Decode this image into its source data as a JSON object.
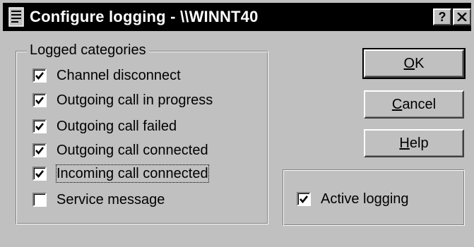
{
  "window": {
    "title": "Configure logging - \\\\WINNT40",
    "help_button": "?",
    "close_button": "✕"
  },
  "logged_categories": {
    "label": "Logged categories",
    "items": [
      {
        "label": "Channel disconnect",
        "checked": true
      },
      {
        "label": "Outgoing call in progress",
        "checked": true
      },
      {
        "label": "Outgoing call failed",
        "checked": true
      },
      {
        "label": "Outgoing call connected",
        "checked": true
      },
      {
        "label": "Incoming call connected",
        "checked": true
      },
      {
        "label": "Service message",
        "checked": false
      }
    ]
  },
  "buttons": {
    "ok": {
      "mnemonic": "O",
      "rest": "K"
    },
    "cancel": {
      "mnemonic": "C",
      "rest": "ancel"
    },
    "help": {
      "mnemonic": "H",
      "rest": "elp"
    }
  },
  "active_logging": {
    "label": "Active logging",
    "checked": true
  }
}
